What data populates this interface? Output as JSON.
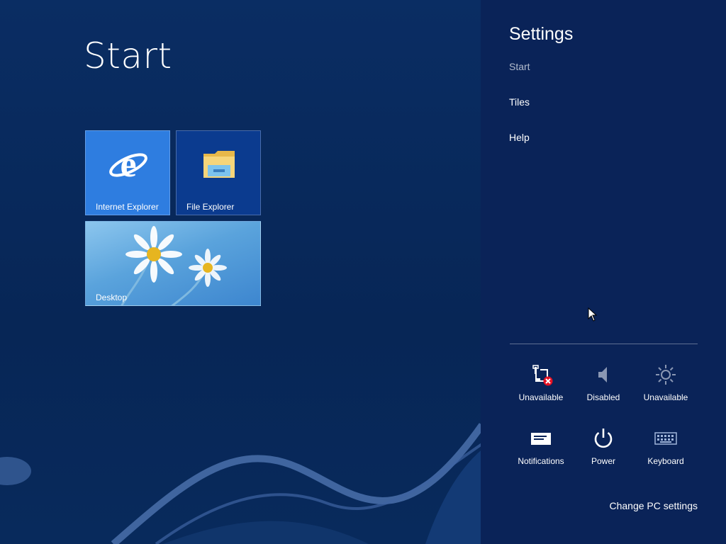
{
  "start": {
    "title": "Start",
    "tiles": [
      {
        "label": "Internet Explorer",
        "icon": "internet-explorer-icon"
      },
      {
        "label": "File Explorer",
        "icon": "folder-icon"
      },
      {
        "label": "Desktop",
        "icon": "desktop-wallpaper"
      }
    ]
  },
  "settings": {
    "title": "Settings",
    "links": [
      "Start",
      "Tiles",
      "Help"
    ],
    "quick_actions": [
      {
        "label": "Unavailable",
        "icon": "network-unavailable-icon"
      },
      {
        "label": "Disabled",
        "icon": "volume-icon"
      },
      {
        "label": "Unavailable",
        "icon": "brightness-icon"
      },
      {
        "label": "Notifications",
        "icon": "notifications-icon"
      },
      {
        "label": "Power",
        "icon": "power-icon"
      },
      {
        "label": "Keyboard",
        "icon": "keyboard-icon"
      }
    ],
    "change_pc_settings": "Change PC settings"
  },
  "colors": {
    "background": "#0a2d63",
    "settings_pane": "#0a2358",
    "ie_tile": "#2e7de0",
    "explorer_tile": "#0b3b8f",
    "error_red": "#e81123"
  }
}
